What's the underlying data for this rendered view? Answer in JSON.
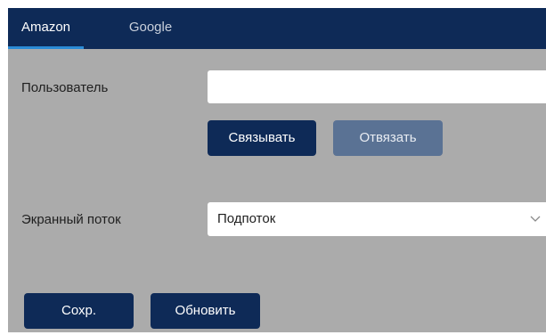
{
  "tabs": [
    {
      "label": "Amazon",
      "active": true
    },
    {
      "label": "Google",
      "active": false
    }
  ],
  "user": {
    "label": "Пользователь",
    "value": "",
    "placeholder": ""
  },
  "actions": {
    "link_label": "Связывать",
    "unlink_label": "Отвязать"
  },
  "stream": {
    "label": "Экранный поток",
    "selected": "Подпоток",
    "icon": "chevron-down-icon"
  },
  "footer": {
    "save_label": "Сохр.",
    "refresh_label": "Обновить"
  },
  "colors": {
    "navy": "#0e2a57",
    "panel": "#ababab",
    "tab_underline": "#2b8bd6",
    "disabled_button": "#5a7294"
  }
}
